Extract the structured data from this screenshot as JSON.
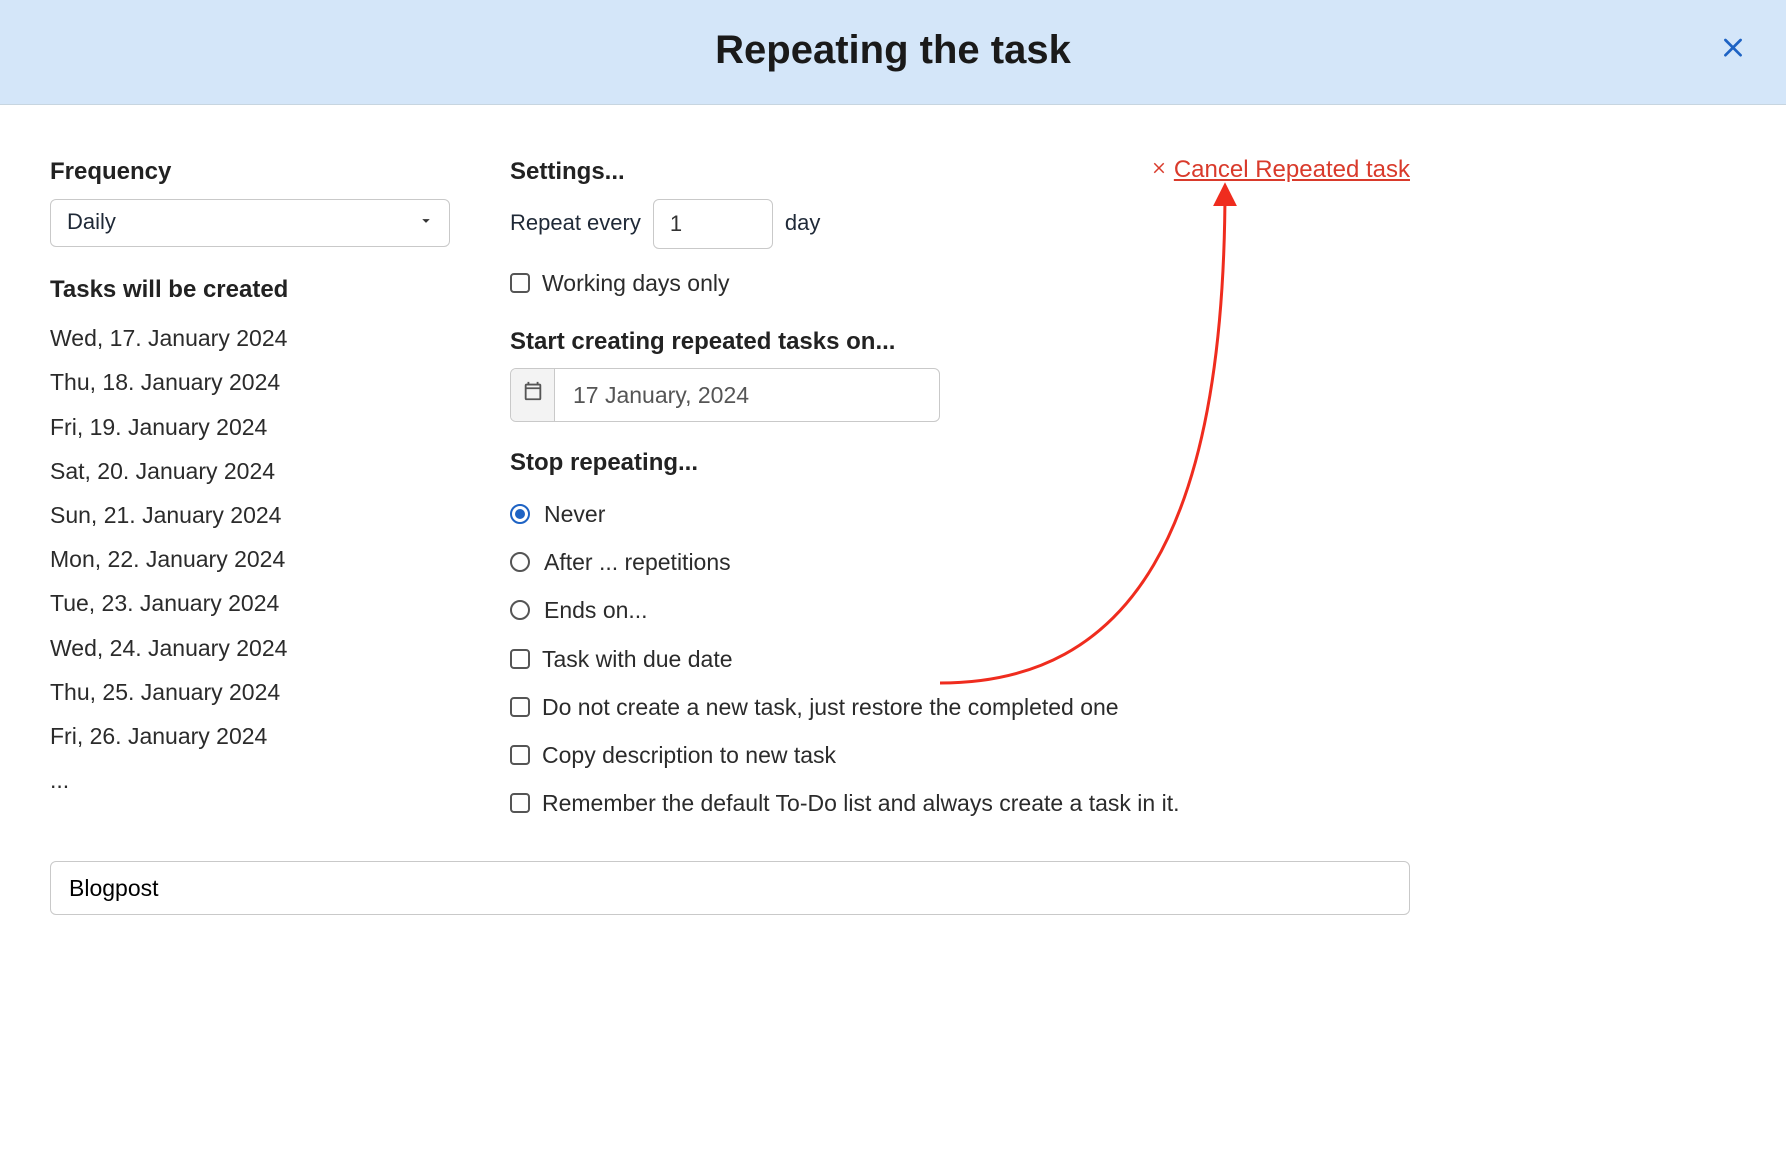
{
  "header": {
    "title": "Repeating the task"
  },
  "cancel_link": "Cancel Repeated task",
  "left": {
    "frequency_label": "Frequency",
    "frequency_value": "Daily",
    "preview_label": "Tasks will be created",
    "preview_dates": [
      "Wed, 17. January 2024",
      "Thu, 18. January 2024",
      "Fri, 19. January 2024",
      "Sat, 20. January 2024",
      "Sun, 21. January 2024",
      "Mon, 22. January 2024",
      "Tue, 23. January 2024",
      "Wed, 24. January 2024",
      "Thu, 25. January 2024",
      "Fri, 26. January 2024",
      "..."
    ]
  },
  "right": {
    "settings_label": "Settings...",
    "repeat_every_prefix": "Repeat every",
    "repeat_every_value": "1",
    "repeat_every_suffix": "day",
    "working_days_label": "Working days only",
    "start_label": "Start creating repeated tasks on...",
    "start_value": "17 January, 2024",
    "stop_label": "Stop repeating...",
    "stop_options": {
      "never": "Never",
      "after": "After ... repetitions",
      "ends_on": "Ends on..."
    },
    "check_options": {
      "due_date": "Task with due date",
      "restore": "Do not create a new task, just restore the completed one",
      "copy_desc": "Copy description to new task",
      "remember_list": "Remember the default To-Do list and always create a task in it."
    }
  },
  "bottom_input_value": "Blogpost",
  "annotation_color": "#ef2c1e"
}
